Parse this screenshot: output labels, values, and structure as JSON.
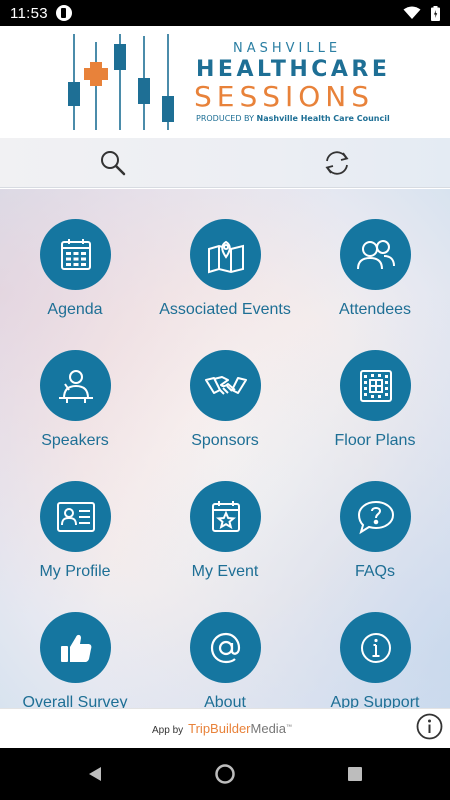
{
  "status_bar": {
    "time": "11:53"
  },
  "header": {
    "brand_top": "NASHVILLE",
    "brand_mid": "HEALTHCARE",
    "brand_bot": "SESSIONS",
    "credit_small": "PRODUCED BY",
    "credit_org": "Nashville Health Care Council",
    "accent_color": "#e8823a",
    "brand_color": "#1e6f95"
  },
  "toolbar": {
    "search_icon": "search-icon",
    "sync_icon": "sync-icon"
  },
  "tiles": [
    {
      "label": "Agenda",
      "icon": "calendar-grid-icon"
    },
    {
      "label": "Associated Events",
      "icon": "map-pin-icon"
    },
    {
      "label": "Attendees",
      "icon": "people-icon"
    },
    {
      "label": "Speakers",
      "icon": "speaker-podium-icon"
    },
    {
      "label": "Sponsors",
      "icon": "handshake-icon"
    },
    {
      "label": "Floor Plans",
      "icon": "floor-plan-icon"
    },
    {
      "label": "My Profile",
      "icon": "id-card-icon"
    },
    {
      "label": "My Event",
      "icon": "calendar-star-icon"
    },
    {
      "label": "FAQs",
      "icon": "question-bubble-icon"
    },
    {
      "label": "Overall Survey",
      "icon": "thumbs-up-icon"
    },
    {
      "label": "About",
      "icon": "at-sign-icon"
    },
    {
      "label": "App Support",
      "icon": "info-icon"
    }
  ],
  "footer": {
    "app_by": "App by",
    "brand_a": "TripBuilder",
    "brand_b": "Media",
    "tm": "™"
  },
  "colors": {
    "tile_circle": "#1576a0",
    "label": "#1e6f95"
  }
}
